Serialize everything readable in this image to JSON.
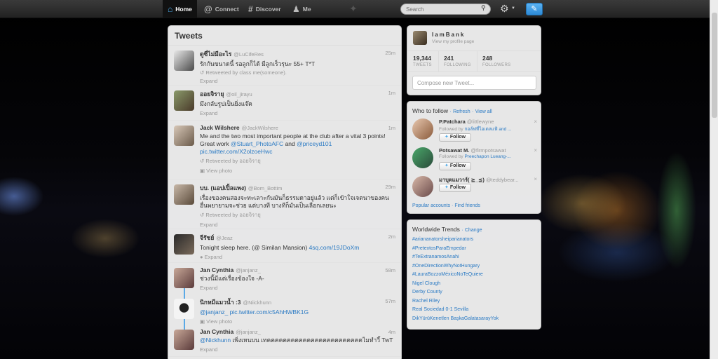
{
  "nav": {
    "home": "Home",
    "connect": "Connect",
    "discover": "Discover",
    "me": "Me"
  },
  "search": {
    "placeholder": "Search"
  },
  "icons": {
    "home": "home-icon",
    "connect": "at-icon",
    "discover": "hash-icon",
    "me": "person-icon",
    "bird": "bird-icon",
    "search": "search-icon",
    "gear": "gear-icon",
    "compose": "compose-icon"
  },
  "colors": {
    "accent": "#2a7ac4",
    "topbar": "#2b2b2b",
    "compose_button": "#3a98e0"
  },
  "tweets": {
    "header": "Tweets",
    "items": [
      {
        "name": "ดูซี่ไม่มีอะไร",
        "handle": "@LuCifeRes",
        "time": "25m",
        "text": "รักกันขนาดนี้ รอลูกก็ได้ มีลูกเร็วรุนะ 55+ T*T",
        "meta": "Retweeted by class me(someone).",
        "action": "Expand"
      },
      {
        "name": "ออยจิรายุ",
        "handle": "@oil_jirayu",
        "time": "1m",
        "text": "มึงกลับรูปเป็นยิ่งแจ๊ค",
        "action": "Expand"
      },
      {
        "name": "Jack Wilshere",
        "handle": "@JackWilshere",
        "time": "1m",
        "text": "Me and the two most important people at the club after a vital 3 points! Great work",
        "mention1": "@Stuart_PhotoAFC",
        "and": "and",
        "mention2": "@priceyd101",
        "link": "pic.twitter.com/X2olzoeHwc",
        "meta": "Retweeted by ออยจิรายุ",
        "action": "View photo"
      },
      {
        "name": "บบ. (แอปเปิ้ลแพง)",
        "handle": "@Bom_Bottim",
        "time": "29m",
        "text": "เรื่องของคนสองจะทะเลาะกันมันก็ธรรมดาอยู่แล้ว แต่ก็เข้าใจเจตนาของคนอื่นพยายามจะช่วย แต่บางที บางทีก็มันเป็นเลือกเลยนะ",
        "meta": "Retweeted by ออยจิรายุ",
        "action": "Expand"
      },
      {
        "name": "จีรัชย์",
        "handle": "@Jeaz",
        "time": "2m",
        "text": "Tonight sleep here. (@ Similan Mansion)",
        "link": "4sq.com/19JDoXm",
        "action": "Expand"
      },
      {
        "name": "Jan Cynthia",
        "handle": "@janjanz_",
        "time": "58m",
        "text": "ช่วงนี้มีแต่เรื่องข้องใจ -A-",
        "action": "Expand"
      },
      {
        "name": "นิกหมีแมวน้ำ :3",
        "handle": "@Niickhunn",
        "time": "57m",
        "mention1": "@janjanz_",
        "link": "pic.twitter.com/c5AhHWBK1G",
        "action": "View photo"
      },
      {
        "name": "Jan Cynthia",
        "handle": "@janjanz_",
        "time": "4m",
        "mention1": "@Nickhunn",
        "text": "เพิ่งเหนบน เทคคคคคคคคคคคคคคคคคคคคคคคคไมทำวี้ TwT",
        "action": "Expand"
      }
    ]
  },
  "profile": {
    "name": "IamBank",
    "subtitle": "View my profile page",
    "tweets_count": "19,344",
    "tweets_label": "TWEETS",
    "following_count": "241",
    "following_label": "FOLLOWING",
    "followers_count": "248",
    "followers_label": "FOLLOWERS",
    "compose_placeholder": "Compose new Tweet..."
  },
  "who_to_follow": {
    "title": "Who to follow",
    "refresh": "Refresh",
    "view_all": "View all",
    "sep": "·",
    "follow_label": "Follow",
    "dismiss": "×",
    "items": [
      {
        "name": "P.Patchara",
        "handle": "@littlewyne",
        "by_prefix": "Followed by",
        "by": "กอล์ฟที่ไอเดลแฟ้ and ..."
      },
      {
        "name": "Potsawat M.",
        "handle": "@firmpotsawat",
        "by_prefix": "Followed by",
        "by": "Preechapon Lueang-..."
      },
      {
        "name": "มาบุตแมวาร์( ≧_≦)",
        "handle": "@teddybear..."
      }
    ],
    "popular": "Popular accounts",
    "find_friends": "Find friends"
  },
  "trends": {
    "title": "Worldwide Trends",
    "change": "Change",
    "items": [
      "#ariananatorsheiparianators",
      "#PretextosParaEmpedar",
      "#TeExtranamosAnahi",
      "#OneDirectionWhyNotHungary",
      "#LauraBozzoMéxicoNoTeQuiere",
      "Nigel Clough",
      "Derby County",
      "Rachel Riley",
      "Real Sociedad 0-1 Sevilla",
      "DikYürüKenetlen BaşkaGalatasarayYok"
    ]
  }
}
